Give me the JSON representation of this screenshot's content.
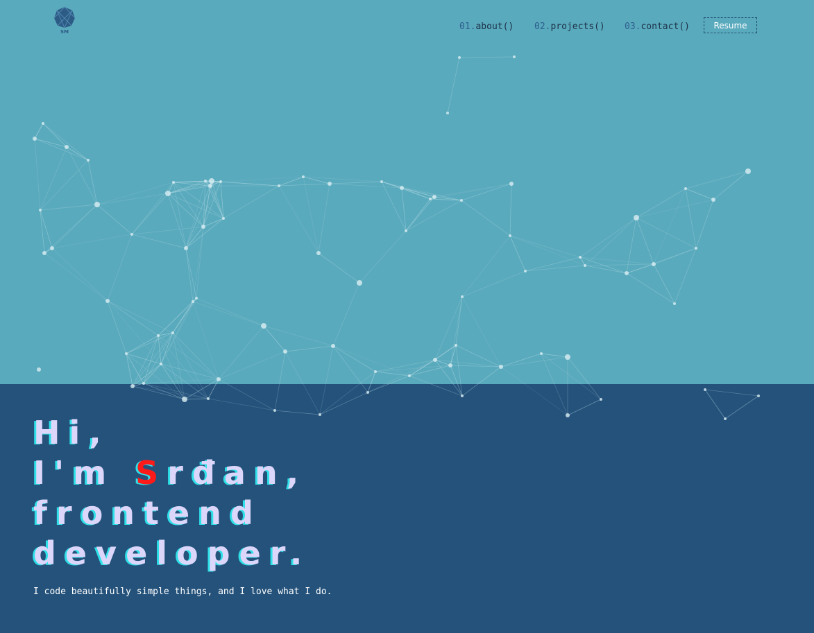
{
  "logo": {
    "text": "SM"
  },
  "nav": {
    "items": [
      {
        "num": "01.",
        "label": "about()"
      },
      {
        "num": "02.",
        "label": "projects()"
      },
      {
        "num": "03.",
        "label": "contact()"
      }
    ],
    "resume_label": "Resume"
  },
  "hero": {
    "line1": "Hi,",
    "line2_prefix": "I'm ",
    "line2_accent": "S",
    "line2_rest": "rđan,",
    "line3": "frontend",
    "line4": "developer.",
    "tagline": "I code beautifully simple things, and I love what I do."
  },
  "colors": {
    "top_background": "#5aaabd",
    "bottom_background": "#24527b",
    "title_fill": "#dcd6fa",
    "title_shadow": "#2ee0e8",
    "accent": "#ff1a1a",
    "nav_text": "#1c3148"
  }
}
